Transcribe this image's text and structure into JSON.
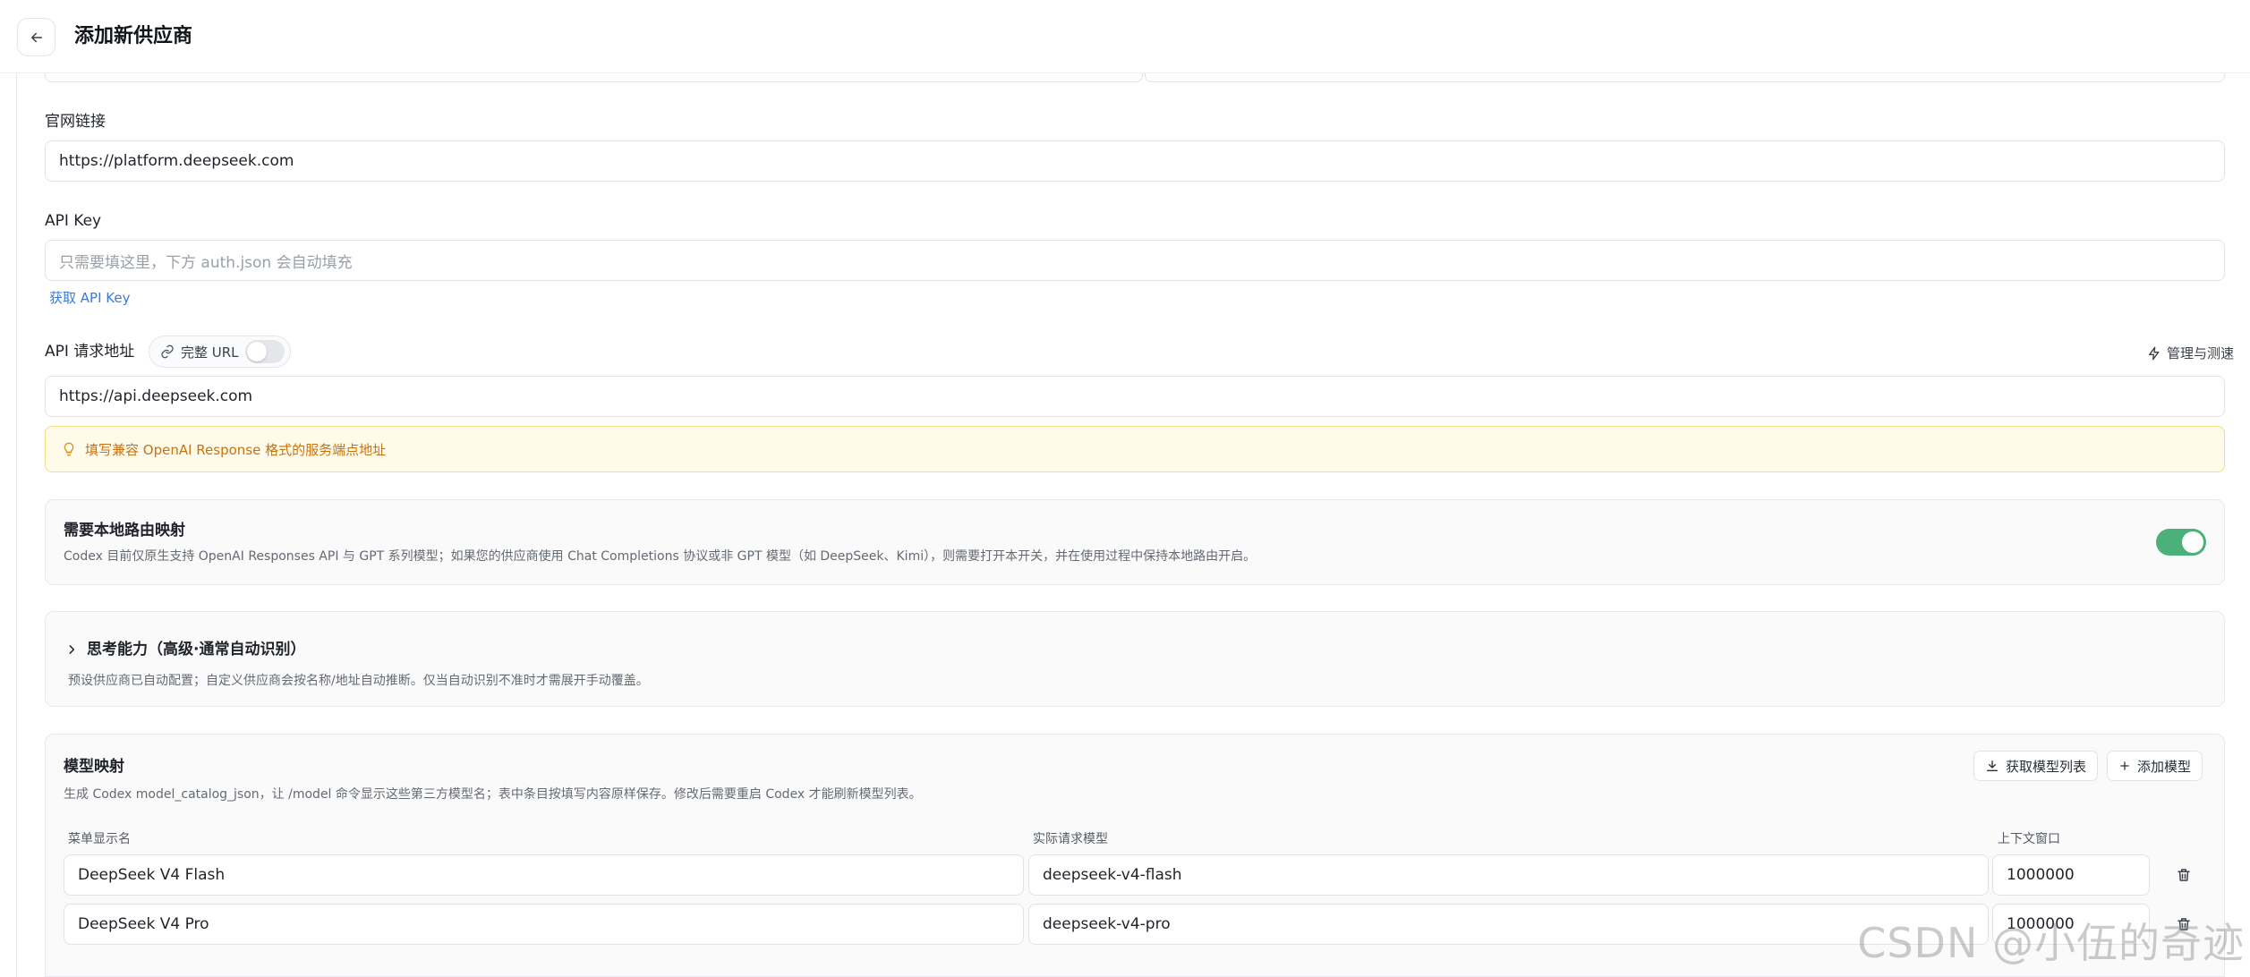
{
  "header": {
    "title": "添加新供应商"
  },
  "website": {
    "label": "官网链接",
    "value": "https://platform.deepseek.com"
  },
  "api_key": {
    "label": "API Key",
    "placeholder": "只需要填这里，下方 auth.json 会自动填充",
    "get_link": "获取 API Key"
  },
  "api_url": {
    "label": "API 请求地址",
    "full_url_label": "完整 URL",
    "full_url_enabled": false,
    "manage_label": "管理与测速",
    "value": "https://api.deepseek.com",
    "hint": "填写兼容 OpenAI Response 格式的服务端点地址"
  },
  "local_routing": {
    "title": "需要本地路由映射",
    "desc": "Codex 目前仅原生支持 OpenAI Responses API 与 GPT 系列模型；如果您的供应商使用 Chat Completions 协议或非 GPT 模型（如 DeepSeek、Kimi），则需要打开本开关，并在使用过程中保持本地路由开启。",
    "enabled": true
  },
  "thinking": {
    "title": "思考能力（高级·通常自动识别）",
    "desc": "预设供应商已自动配置；自定义供应商会按名称/地址自动推断。仅当自动识别不准时才需展开手动覆盖。"
  },
  "model_mapping": {
    "title": "模型映射",
    "desc": "生成 Codex model_catalog_json，让 /model 命令显示这些第三方模型名；表中条目按填写内容原样保存。修改后需要重启 Codex 才能刷新模型列表。",
    "fetch_label": "获取模型列表",
    "add_label": "添加模型",
    "columns": [
      "菜单显示名",
      "实际请求模型",
      "上下文窗口"
    ],
    "rows": [
      {
        "display": "DeepSeek V4 Flash",
        "model": "deepseek-v4-flash",
        "context": "1000000"
      },
      {
        "display": "DeepSeek V4 Pro",
        "model": "deepseek-v4-pro",
        "context": "1000000"
      }
    ]
  },
  "watermark": "CSDN @小伍的奇迹",
  "colors": {
    "accent": "#3a7bd5",
    "toggle_on": "#4bb07a",
    "warning_bg": "#fffbea",
    "warning_text": "#c8720f"
  }
}
